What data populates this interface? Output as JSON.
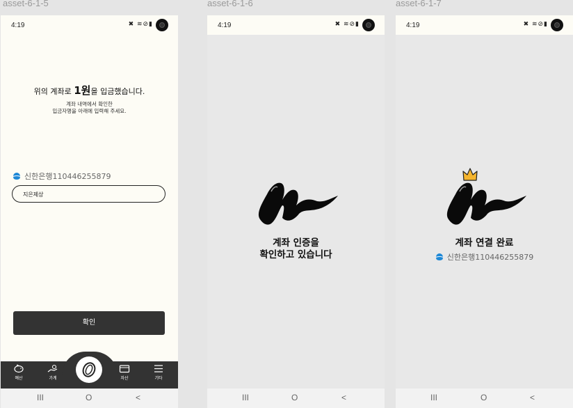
{
  "assets": [
    "asset-6-1-5",
    "asset-6-1-6",
    "asset-6-1-7"
  ],
  "status": {
    "time": "4:19",
    "icons": "✖ ≋⊘▮"
  },
  "nav": {
    "recent": "III",
    "home": "O",
    "back": "<"
  },
  "screen1": {
    "title_pre": "위의 계좌로 ",
    "title_bold": "1원",
    "title_post": "을 입금했습니다.",
    "sub_line1": "계좌 내역에서 확인한",
    "sub_line2": "입금자명을 아래에 입력해 주세요.",
    "bank_account": "신한은행110446255879",
    "input_value": "지은제상",
    "confirm_label": "확인",
    "tabs": [
      "예산",
      "가계",
      "자산",
      "기타"
    ]
  },
  "screen2": {
    "line1": "계좌 인증을",
    "line2": "확인하고 있습니다"
  },
  "screen3": {
    "title": "계좌 연결 완료",
    "bank_account": "신한은행110446255879"
  },
  "colors": {
    "dark": "#333333",
    "cream": "#fdfcf5",
    "gray_bg": "#e8e8e8",
    "bank_blue": "#1e88d6",
    "crown": "#f5b52e"
  }
}
